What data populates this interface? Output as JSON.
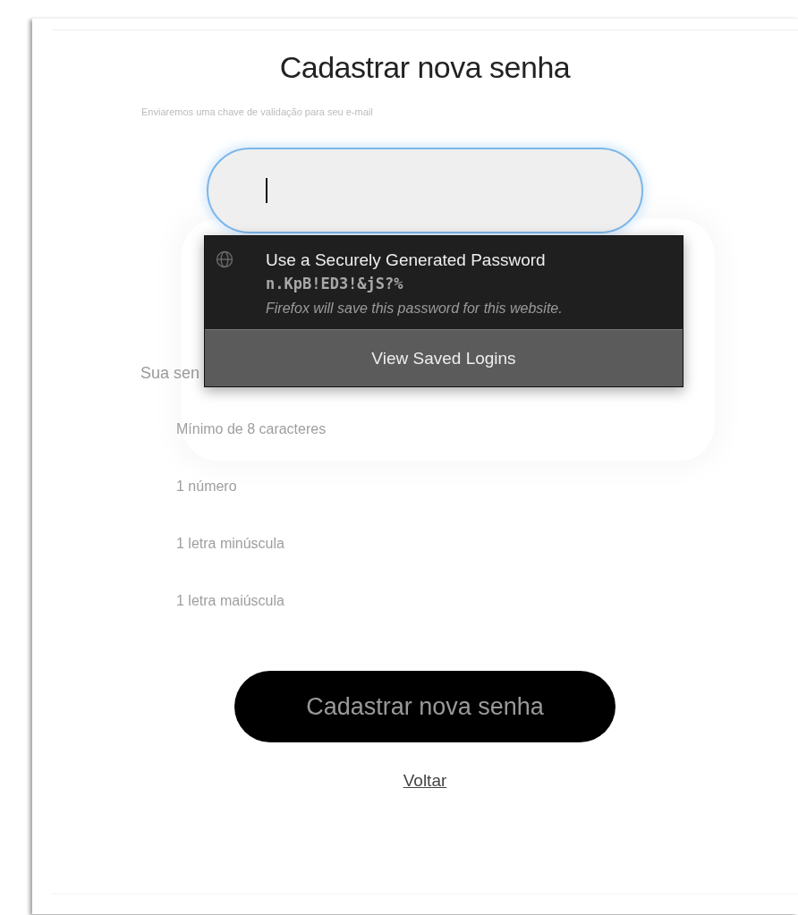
{
  "page": {
    "title": "Cadastrar nova senha",
    "subtitle": "Enviaremos uma chave de validação para seu e-mail"
  },
  "password_field": {
    "focused": true
  },
  "requirements": {
    "heading": "Sua sen",
    "items": [
      "Mínimo de 8 caracteres",
      "1 número",
      "1 letra minúscula",
      "1 letra maiúscula"
    ]
  },
  "submit_button": "Cadastrar nova senha",
  "back_link": "Voltar",
  "autofill_popup": {
    "title": "Use a Securely Generated Password",
    "password": "n.KpB!ED3!&jS?%",
    "note": "Firefox will save this password for this website.",
    "footer_button": "View Saved Logins"
  }
}
